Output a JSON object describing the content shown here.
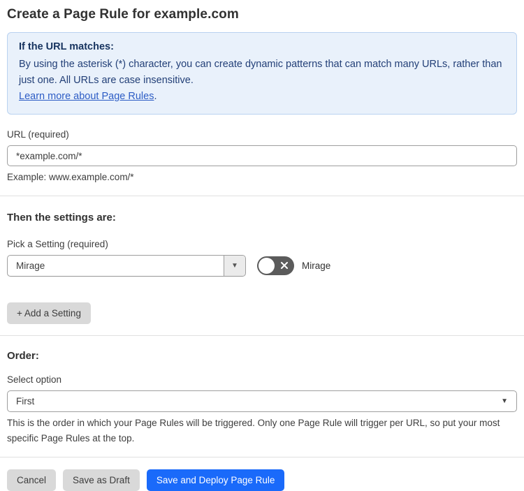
{
  "page": {
    "title": "Create a Page Rule for example.com"
  },
  "info_box": {
    "heading": "If the URL matches:",
    "body": "By using the asterisk (*) character, you can create dynamic patterns that can match many URLs, rather than just one. All URLs are case insensitive.",
    "link_label": "Learn more about Page Rules",
    "link_suffix": "."
  },
  "url_field": {
    "label": "URL (required)",
    "value": "*example.com/*",
    "helper": "Example: www.example.com/*"
  },
  "settings_section": {
    "heading": "Then the settings are:",
    "picker_label": "Pick a Setting (required)",
    "selected_setting": "Mirage",
    "dropdown_arrow": "▼",
    "toggle_label": "Mirage",
    "toggle_state": "off",
    "add_setting_button": "+ Add a Setting"
  },
  "order_section": {
    "heading": "Order:",
    "select_label": "Select option",
    "selected_option": "First",
    "dropdown_arrow": "▼",
    "helper": "This is the order in which your Page Rules will be triggered. Only one Page Rule will trigger per URL, so put your most specific Page Rules at the top."
  },
  "footer": {
    "cancel_label": "Cancel",
    "save_draft_label": "Save as Draft",
    "save_deploy_label": "Save and Deploy Page Rule"
  },
  "colors": {
    "info_box_background": "#e9f1fb",
    "info_box_border": "#b9d2f0",
    "info_text": "#223f77",
    "link_blue": "#2c5cc5",
    "primary_button_blue": "#1a6afa",
    "gray_button": "#d9d9d9",
    "toggle_off_gray": "#5b5b5b",
    "divider": "#e0e0e0"
  }
}
